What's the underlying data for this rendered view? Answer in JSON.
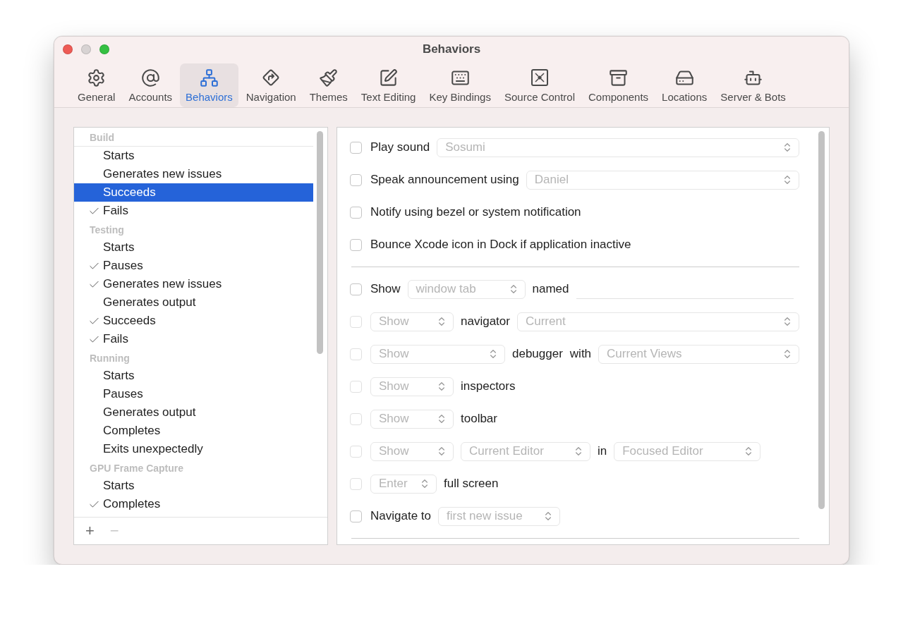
{
  "window": {
    "title": "Behaviors"
  },
  "toolbar": {
    "items": [
      {
        "label": "General",
        "selected": false
      },
      {
        "label": "Accounts",
        "selected": false
      },
      {
        "label": "Behaviors",
        "selected": true
      },
      {
        "label": "Navigation",
        "selected": false
      },
      {
        "label": "Themes",
        "selected": false
      },
      {
        "label": "Text Editing",
        "selected": false
      },
      {
        "label": "Key Bindings",
        "selected": false
      },
      {
        "label": "Source Control",
        "selected": false
      },
      {
        "label": "Components",
        "selected": false
      },
      {
        "label": "Locations",
        "selected": false
      },
      {
        "label": "Server & Bots",
        "selected": false
      }
    ]
  },
  "sidebar": {
    "groups": [
      {
        "title": "Build",
        "items": [
          {
            "label": "Starts",
            "checked": false,
            "selected": false
          },
          {
            "label": "Generates new issues",
            "checked": false,
            "selected": false
          },
          {
            "label": "Succeeds",
            "checked": false,
            "selected": true
          },
          {
            "label": "Fails",
            "checked": true,
            "selected": false
          }
        ]
      },
      {
        "title": "Testing",
        "items": [
          {
            "label": "Starts",
            "checked": false,
            "selected": false
          },
          {
            "label": "Pauses",
            "checked": true,
            "selected": false
          },
          {
            "label": "Generates new issues",
            "checked": true,
            "selected": false
          },
          {
            "label": "Generates output",
            "checked": false,
            "selected": false
          },
          {
            "label": "Succeeds",
            "checked": true,
            "selected": false
          },
          {
            "label": "Fails",
            "checked": true,
            "selected": false
          }
        ]
      },
      {
        "title": "Running",
        "items": [
          {
            "label": "Starts",
            "checked": false,
            "selected": false
          },
          {
            "label": "Pauses",
            "checked": false,
            "selected": false
          },
          {
            "label": "Generates output",
            "checked": false,
            "selected": false
          },
          {
            "label": "Completes",
            "checked": false,
            "selected": false
          },
          {
            "label": "Exits unexpectedly",
            "checked": false,
            "selected": false
          }
        ]
      },
      {
        "title": "GPU Frame Capture",
        "items": [
          {
            "label": "Starts",
            "checked": false,
            "selected": false
          },
          {
            "label": "Completes",
            "checked": true,
            "selected": false
          }
        ]
      }
    ],
    "footer_buttons": [
      {
        "label": "+",
        "disabled": false
      },
      {
        "label": "−",
        "disabled": true
      }
    ]
  },
  "actions": [
    {
      "kind": "row",
      "checked": false,
      "disabled": false,
      "parts": [
        {
          "kind": "label",
          "text": "Play sound"
        },
        {
          "kind": "select",
          "value": "Sosumi"
        }
      ]
    },
    {
      "kind": "row",
      "checked": false,
      "disabled": false,
      "parts": [
        {
          "kind": "label",
          "text": "Speak announcement using"
        },
        {
          "kind": "select",
          "value": "Daniel"
        }
      ]
    },
    {
      "kind": "row",
      "checked": false,
      "disabled": false,
      "parts": [
        {
          "kind": "label",
          "text": "Notify using bezel or system notification"
        }
      ]
    },
    {
      "kind": "row",
      "checked": false,
      "disabled": false,
      "parts": [
        {
          "kind": "label",
          "text": "Bounce Xcode icon in Dock if application inactive"
        }
      ]
    },
    {
      "kind": "divider"
    },
    {
      "kind": "row",
      "checked": false,
      "disabled": false,
      "parts": [
        {
          "kind": "label",
          "text": "Show"
        },
        {
          "kind": "select",
          "value": "window tab"
        },
        {
          "kind": "label",
          "text": "named"
        },
        {
          "kind": "field"
        }
      ]
    },
    {
      "kind": "row",
      "checked": false,
      "disabled": true,
      "parts": [
        {
          "kind": "select",
          "value": "Show"
        },
        {
          "kind": "label",
          "text": "navigator"
        },
        {
          "kind": "select",
          "value": "Current"
        }
      ]
    },
    {
      "kind": "row",
      "checked": false,
      "disabled": true,
      "parts": [
        {
          "kind": "select",
          "value": "Show"
        },
        {
          "kind": "label",
          "text": "debugger"
        },
        {
          "kind": "label",
          "text": "with"
        },
        {
          "kind": "select",
          "value": "Current Views"
        }
      ]
    },
    {
      "kind": "row",
      "checked": false,
      "disabled": true,
      "parts": [
        {
          "kind": "select",
          "value": "Show"
        },
        {
          "kind": "label",
          "text": "inspectors"
        }
      ]
    },
    {
      "kind": "row",
      "checked": false,
      "disabled": true,
      "parts": [
        {
          "kind": "select",
          "value": "Show"
        },
        {
          "kind": "label",
          "text": "toolbar"
        }
      ]
    },
    {
      "kind": "row",
      "checked": false,
      "disabled": true,
      "parts": [
        {
          "kind": "select",
          "value": "Show"
        },
        {
          "kind": "select",
          "value": "Current Editor"
        },
        {
          "kind": "label",
          "text": "in"
        },
        {
          "kind": "select",
          "value": "Focused Editor"
        }
      ]
    },
    {
      "kind": "row",
      "checked": false,
      "disabled": true,
      "parts": [
        {
          "kind": "select",
          "value": "Enter"
        },
        {
          "kind": "label",
          "text": "full screen"
        }
      ]
    },
    {
      "kind": "row",
      "checked": false,
      "disabled": false,
      "parts": [
        {
          "kind": "label",
          "text": "Navigate to"
        },
        {
          "kind": "select",
          "value": "first new issue"
        }
      ]
    },
    {
      "kind": "divider"
    }
  ]
}
